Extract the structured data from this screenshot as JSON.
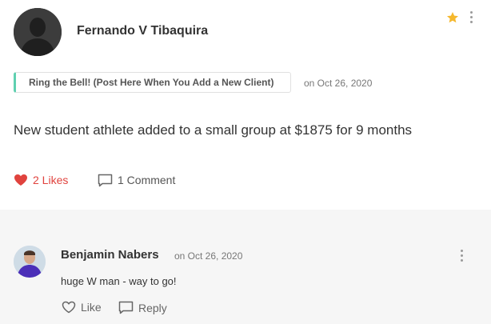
{
  "post": {
    "author": "Fernando V Tibaquira",
    "category": "Ring the Bell! (Post Here When You Add a New Client)",
    "date": "on Oct 26, 2020",
    "body": "New student athlete added to a small group at $1875 for 9 months",
    "likes_label": "2 Likes",
    "comments_label": "1 Comment",
    "starred": true,
    "colors": {
      "like": "#e0433e",
      "star": "#f5b82e",
      "category_accent": "#5fd0b0"
    }
  },
  "comment": {
    "author": "Benjamin Nabers",
    "date": "on Oct 26, 2020",
    "text": "huge W man - way to go!",
    "like_label": "Like",
    "reply_label": "Reply"
  }
}
